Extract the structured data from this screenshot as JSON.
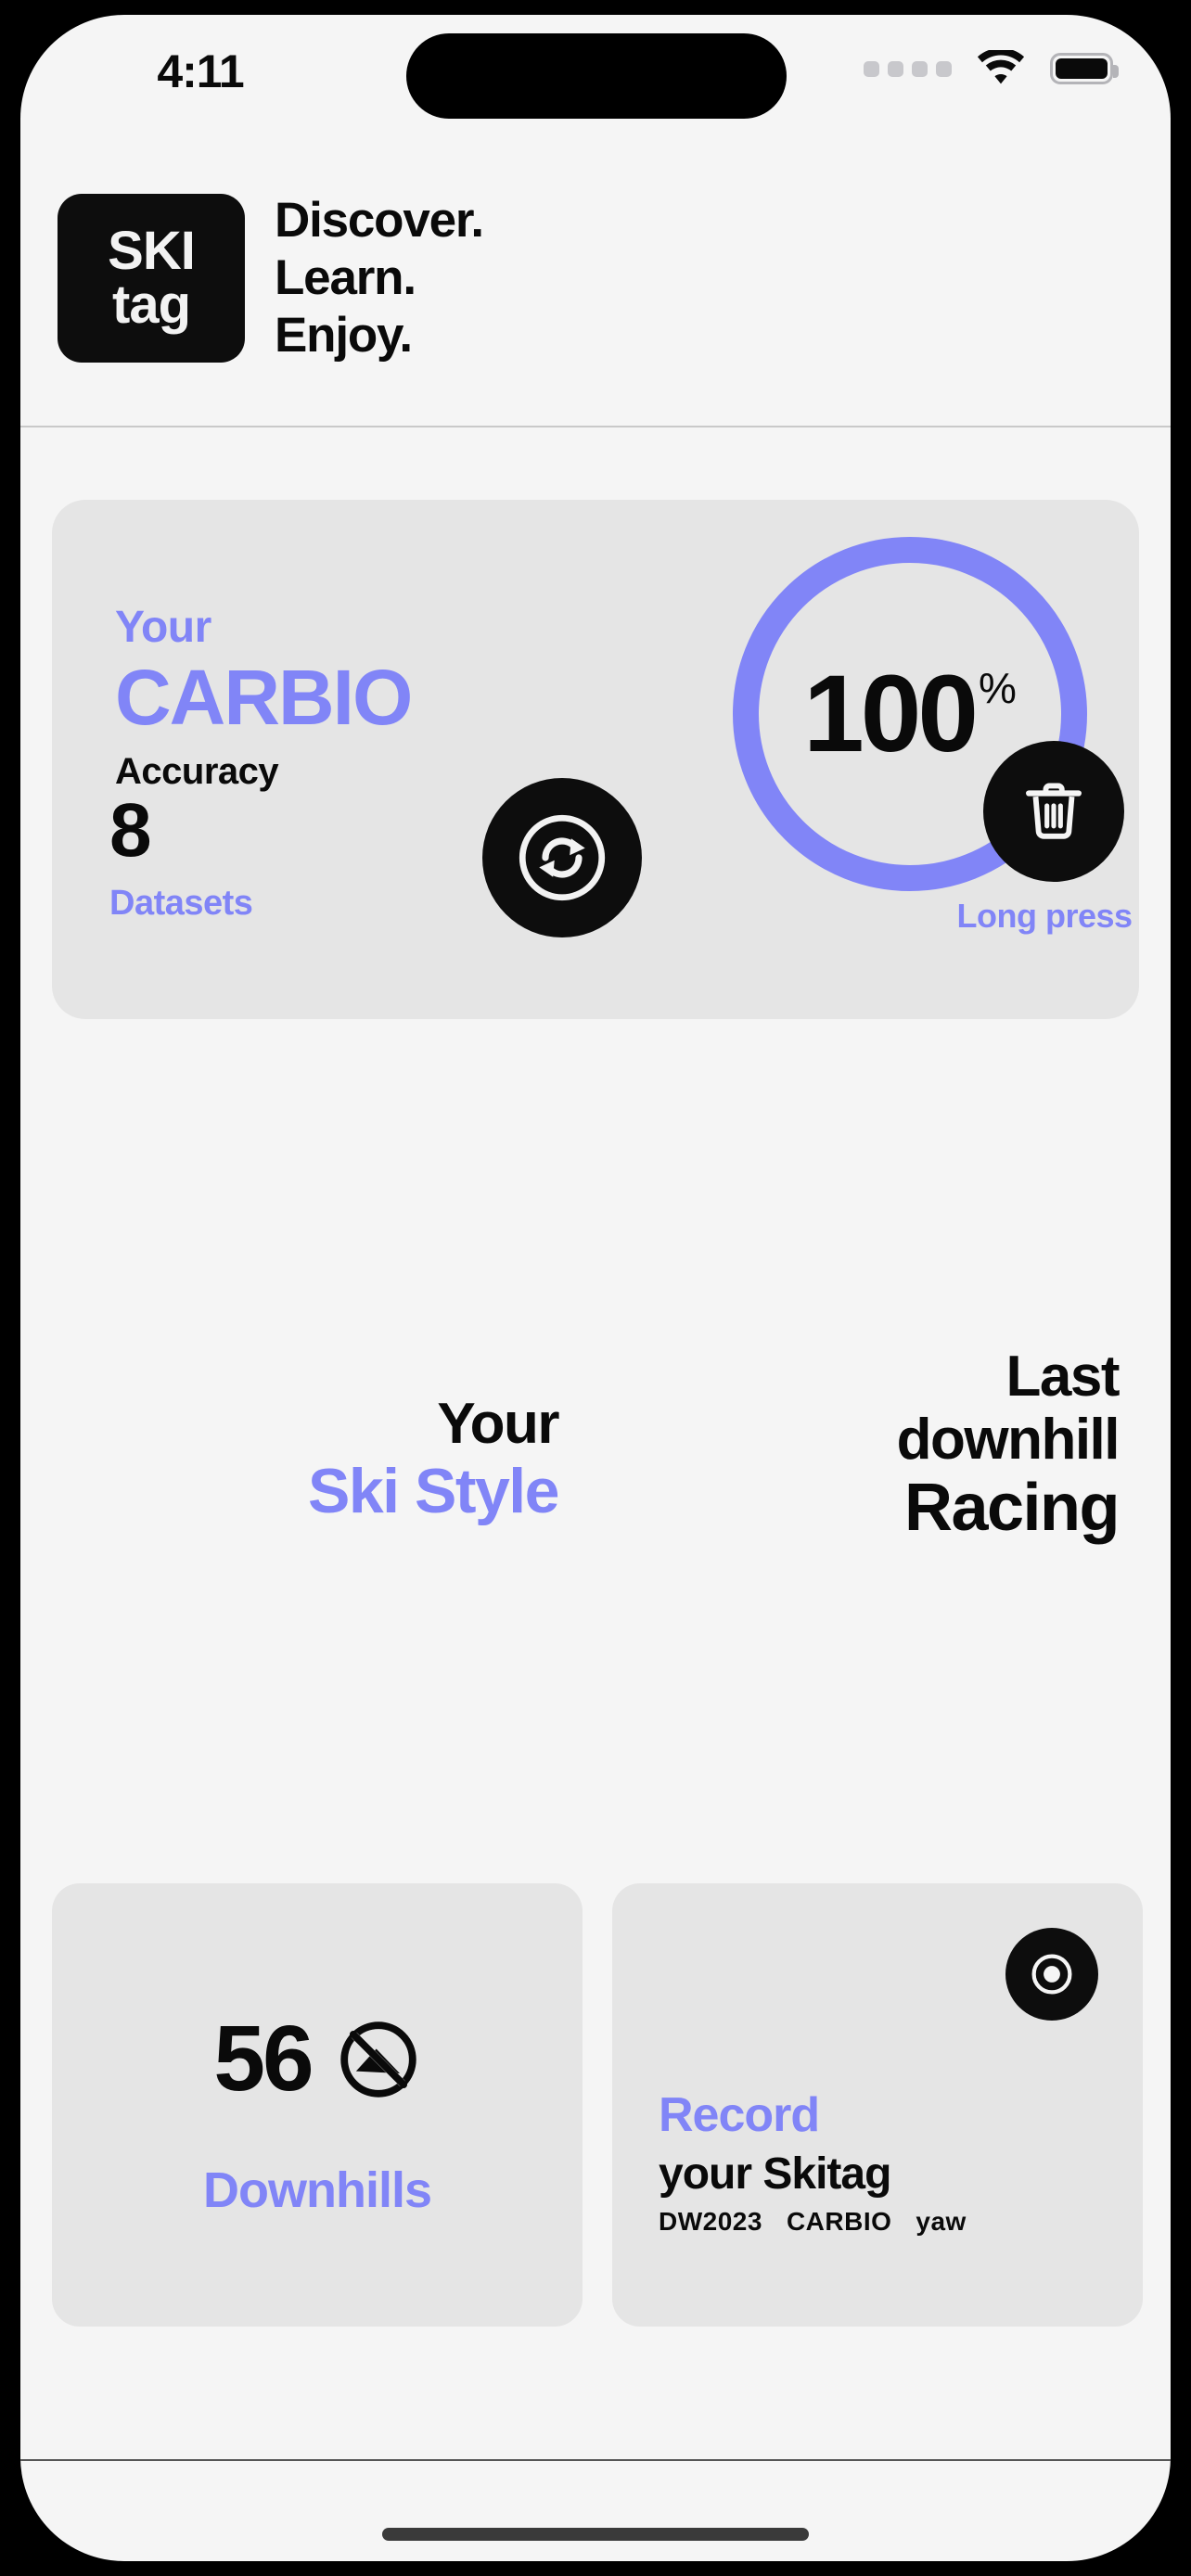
{
  "statusbar": {
    "time": "4:11",
    "cellular_icon": "cellular-dots-icon",
    "wifi_icon": "wifi-icon",
    "battery_icon": "battery-full-icon"
  },
  "header": {
    "logo_line1": "SKI",
    "logo_line2": "tag",
    "tagline_line1": "Discover.",
    "tagline_line2": "Learn.",
    "tagline_line3": "Enjoy."
  },
  "hero": {
    "eyebrow": "Your",
    "title": "CARBIO",
    "subtitle": "Accuracy",
    "gauge_value": "100",
    "gauge_unit": "%",
    "datasets_count": "8",
    "datasets_label": "Datasets",
    "sync_icon": "sync-refresh-icon",
    "delete_icon": "trash-icon",
    "delete_hint": "Long press"
  },
  "headings": {
    "left_line1": "Your",
    "left_line2": "Ski Style",
    "right_line1": "Last",
    "right_line2": "downhill",
    "right_line3": "Racing"
  },
  "cards": {
    "downhills": {
      "count": "56",
      "status_icon": "no-entry-slope-icon",
      "label": "Downhills"
    },
    "record": {
      "record_icon": "record-target-icon",
      "title": "Record",
      "subtitle": "your Skitag",
      "meta_1": "DW2023",
      "meta_2": "CARBIO",
      "meta_3": "yaw"
    }
  },
  "colors": {
    "accent": "#8185f7",
    "card_bg": "#e5e5e5",
    "page_bg": "#f5f5f5",
    "ink": "#0a0a0a"
  }
}
